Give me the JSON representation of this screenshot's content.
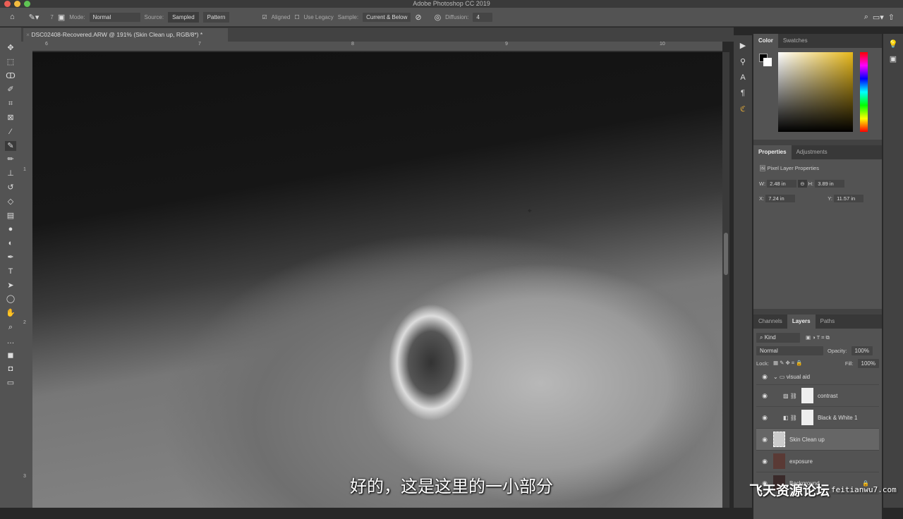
{
  "app_title": "Adobe Photoshop CC 2019",
  "options": {
    "brush_size": "7",
    "mode_label": "Mode:",
    "mode_value": "Normal",
    "source_label": "Source:",
    "source_sampled": "Sampled",
    "source_pattern": "Pattern",
    "aligned_label": "Aligned",
    "legacy_label": "Use Legacy",
    "sample_label": "Sample:",
    "sample_value": "Current & Below",
    "diffusion_label": "Diffusion:",
    "diffusion_value": "4"
  },
  "document_tab": "DSC02408-Recovered.ARW @ 191% (Skin Clean up, RGB/8*) *",
  "ruler_top": [
    "6",
    "7",
    "8",
    "9",
    "10"
  ],
  "ruler_left": [
    "1",
    "2",
    "3"
  ],
  "color_panel": {
    "tabs": [
      "Color",
      "Swatches"
    ]
  },
  "properties": {
    "tabs": [
      "Properties",
      "Adjustments"
    ],
    "title": "Pixel Layer Properties",
    "w_label": "W:",
    "w": "2.48 in",
    "h_label": "H:",
    "h": "3.89 in",
    "x_label": "X:",
    "x": "7.24 in",
    "y_label": "Y:",
    "y": "11.57 in"
  },
  "layers_panel": {
    "tabs": [
      "Channels",
      "Layers",
      "Paths"
    ],
    "filter": "Kind",
    "blend": "Normal",
    "opacity_label": "Opacity:",
    "opacity": "100%",
    "lock_label": "Lock:",
    "fill_label": "Fill:",
    "fill": "100%",
    "layers": [
      {
        "name": "visual aid",
        "type": "group"
      },
      {
        "name": "contrast",
        "type": "adjustment"
      },
      {
        "name": "Black & White 1",
        "type": "adjustment"
      },
      {
        "name": "Skin Clean up",
        "type": "pixel",
        "selected": true
      },
      {
        "name": "exposure",
        "type": "photo"
      },
      {
        "name": "Background",
        "type": "photo",
        "locked": true
      }
    ]
  },
  "subtitle": "好的，这是这里的一小部分",
  "watermark": {
    "text": "飞天资源论坛",
    "url": "feitianwu7.com"
  }
}
